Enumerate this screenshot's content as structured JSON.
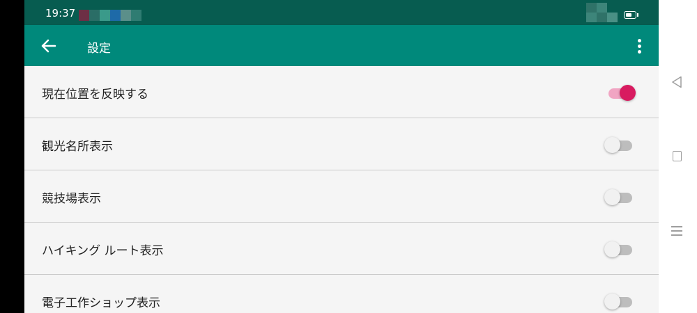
{
  "status_bar": {
    "time": "19:37",
    "notification_icon_colors": [
      "#6d2f45",
      "#2a6d66",
      "#3a9a8a",
      "#1e6aa8",
      "#5b8f8a",
      "#2f7c72"
    ],
    "battery_icon": "battery-icon"
  },
  "toolbar": {
    "back_icon": "arrow-left-icon",
    "title": "設定",
    "overflow_icon": "more-vert-icon",
    "background": "#00897b"
  },
  "settings": [
    {
      "label": "現在位置を反映する",
      "enabled": true
    },
    {
      "label": "観光名所表示",
      "enabled": false
    },
    {
      "label": "競技場表示",
      "enabled": false
    },
    {
      "label": "ハイキング ルート表示",
      "enabled": false
    },
    {
      "label": "電子工作ショップ表示",
      "enabled": false
    }
  ],
  "colors": {
    "status_bar": "#075c50",
    "accent": "#d81b60",
    "switch_off": "#bdbdbd"
  },
  "nav_bar": {
    "back_icon": "triangle-back-icon",
    "home_icon": "square-home-icon",
    "menu_icon": "menu-lines-icon"
  }
}
